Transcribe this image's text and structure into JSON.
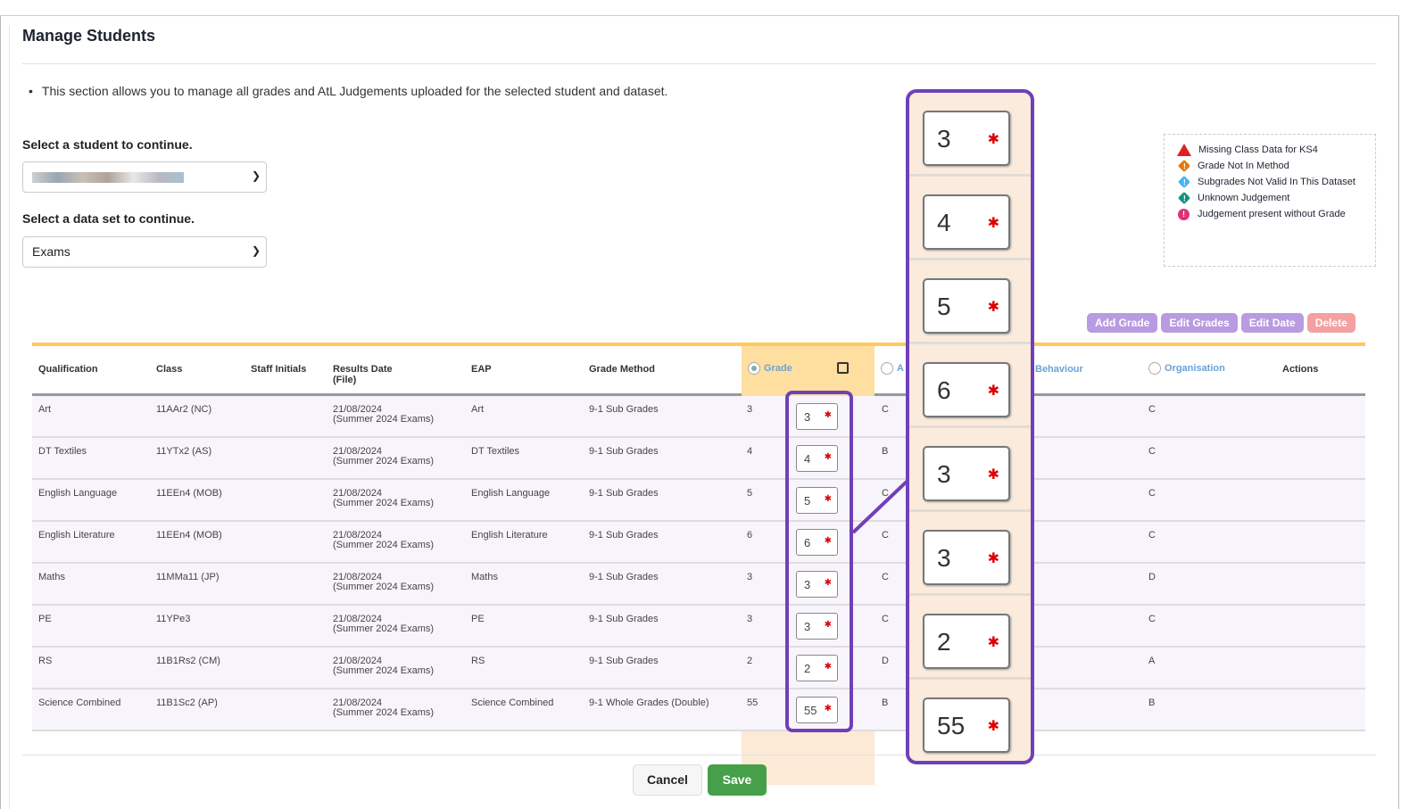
{
  "title": "Manage Students",
  "intro": "This section allows you to manage all grades and AtL Judgements uploaded for the selected student and dataset.",
  "student_label": "Select a student to continue.",
  "dataset_label": "Select a data set to continue.",
  "dataset_value": "Exams",
  "legend": [
    {
      "icon": "warning-triangle-icon",
      "color": "#e02020",
      "text": "Missing Class Data for KS4"
    },
    {
      "icon": "orange-diamond-icon",
      "color": "#e07a10",
      "text": "Grade Not In Method"
    },
    {
      "icon": "blue-diamond-icon",
      "color": "#4ab4f0",
      "text": "Subgrades Not Valid In This Dataset"
    },
    {
      "icon": "teal-diamond-icon",
      "color": "#16907f",
      "text": "Unknown Judgement"
    },
    {
      "icon": "pink-circle-icon",
      "color": "#e0307a",
      "text": "Judgement present without Grade"
    }
  ],
  "actions": {
    "add": "Add Grade",
    "edit_grades": "Edit Grades",
    "edit_date": "Edit Date",
    "delete": "Delete"
  },
  "headers": {
    "qualification": "Qualification",
    "class": "Class",
    "staff": "Staff Initials",
    "date": "Results Date",
    "date_sub": "(File)",
    "eap": "EAP",
    "method": "Grade Method",
    "grade": "Grade",
    "a": "A",
    "behaviour": "Behaviour",
    "organisation": "Organisation",
    "actions": "Actions"
  },
  "rows": [
    {
      "qual": "Art",
      "class": "11AAr2 (NC)",
      "date": "21/08/2024",
      "file": "(Summer 2024 Exams)",
      "eap": "Art",
      "method": "9-1 Sub Grades",
      "grade": "3",
      "input": "3",
      "a": "C",
      "org": "C"
    },
    {
      "qual": "DT Textiles",
      "class": "11YTx2 (AS)",
      "date": "21/08/2024",
      "file": "(Summer 2024 Exams)",
      "eap": "DT Textiles",
      "method": "9-1 Sub Grades",
      "grade": "4",
      "input": "4",
      "a": "B",
      "org": "C"
    },
    {
      "qual": "English Language",
      "class": "11EEn4 (MOB)",
      "date": "21/08/2024",
      "file": "(Summer 2024 Exams)",
      "eap": "English Language",
      "method": "9-1 Sub Grades",
      "grade": "5",
      "input": "5",
      "a": "C",
      "org": "C"
    },
    {
      "qual": "English Literature",
      "class": "11EEn4 (MOB)",
      "date": "21/08/2024",
      "file": "(Summer 2024 Exams)",
      "eap": "English Literature",
      "method": "9-1 Sub Grades",
      "grade": "6",
      "input": "6",
      "a": "C",
      "org": "C"
    },
    {
      "qual": "Maths",
      "class": "11MMa11 (JP)",
      "date": "21/08/2024",
      "file": "(Summer 2024 Exams)",
      "eap": "Maths",
      "method": "9-1 Sub Grades",
      "grade": "3",
      "input": "3",
      "a": "C",
      "org": "D"
    },
    {
      "qual": "PE",
      "class": "11YPe3",
      "date": "21/08/2024",
      "file": "(Summer 2024 Exams)",
      "eap": "PE",
      "method": "9-1 Sub Grades",
      "grade": "3",
      "input": "3",
      "a": "C",
      "org": "C"
    },
    {
      "qual": "RS",
      "class": "11B1Rs2 (CM)",
      "date": "21/08/2024",
      "file": "(Summer 2024 Exams)",
      "eap": "RS",
      "method": "9-1 Sub Grades",
      "grade": "2",
      "input": "2",
      "a": "D",
      "org": "A"
    },
    {
      "qual": "Science Combined",
      "class": "11B1Sc2 (AP)",
      "date": "21/08/2024",
      "file": "(Summer 2024 Exams)",
      "eap": "Science Combined",
      "method": "9-1 Whole Grades (Double)",
      "grade": "55",
      "input": "55",
      "a": "B",
      "org": "B"
    }
  ],
  "footer": {
    "cancel": "Cancel",
    "save": "Save"
  }
}
